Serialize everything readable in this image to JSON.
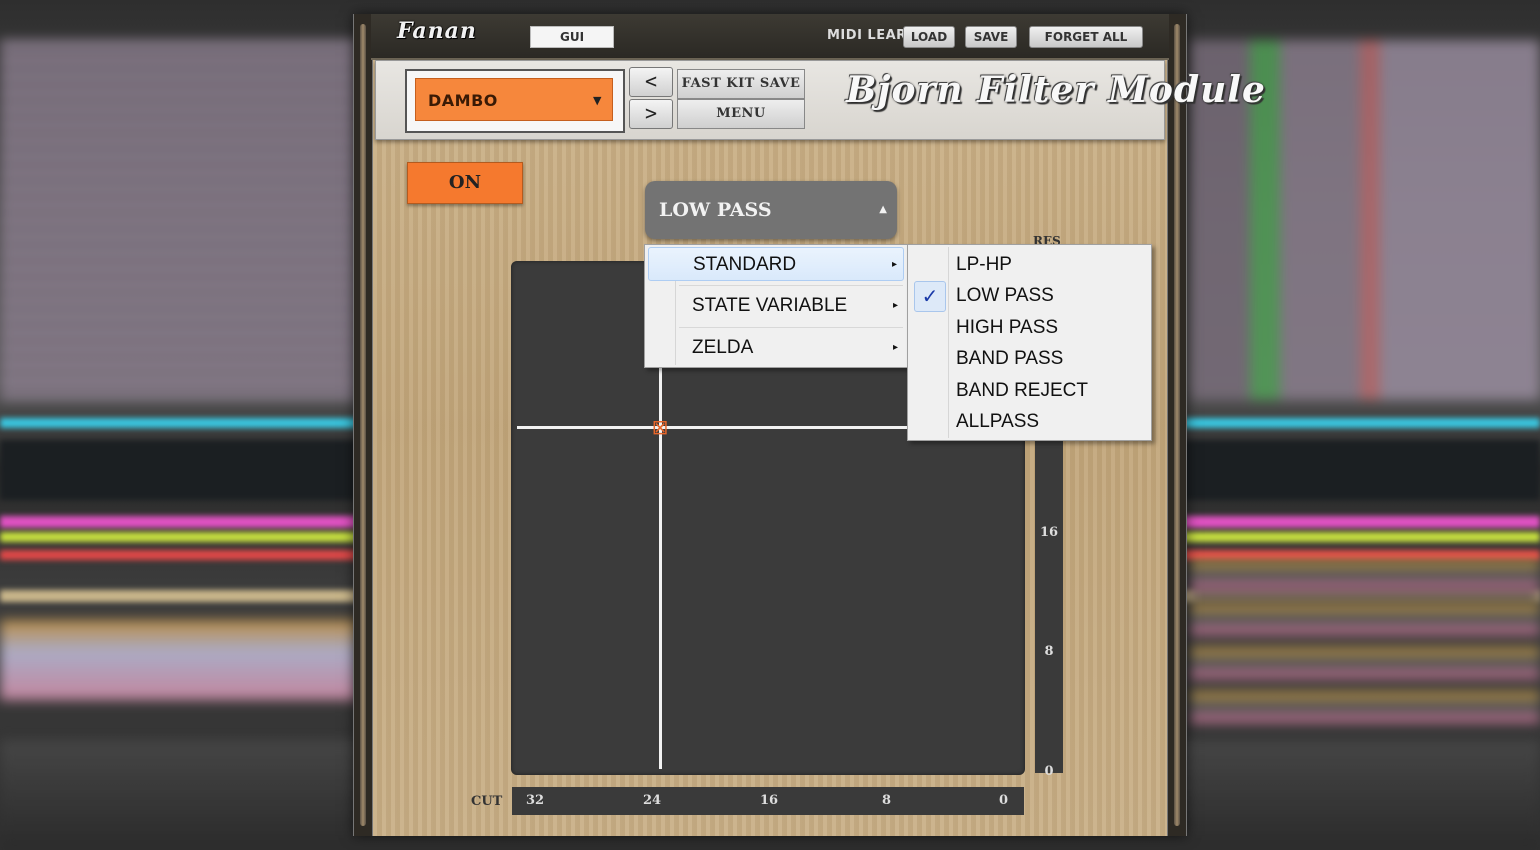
{
  "topbar": {
    "logo_text": "Fanan",
    "gui_label": "GUI",
    "midi_learn_label": "MIDI LEARN",
    "load_label": "LOAD",
    "save_label": "SAVE",
    "forget_all_label": "FORGET ALL"
  },
  "header": {
    "kit_name": "DAMBO",
    "prev_label": "<",
    "next_label": ">",
    "fast_kit_save_label": "FAST KIT SAVE",
    "menu_label": "MENU",
    "title_logo": "Bjorn Filter Module"
  },
  "controls": {
    "on_label": "ON",
    "filter_type": "LOW PASS",
    "res_label": "RES",
    "res_ticks": [
      "16",
      "8",
      "0"
    ],
    "cut_label": "CUT",
    "cut_ticks": [
      "32",
      "24",
      "16",
      "8",
      "0"
    ]
  },
  "menu": {
    "categories": [
      {
        "label": "STANDARD",
        "highlighted": true
      },
      {
        "label": "STATE VARIABLE",
        "highlighted": false
      },
      {
        "label": "ZELDA",
        "highlighted": false
      }
    ],
    "standard_items": [
      {
        "label": "LP-HP",
        "checked": false
      },
      {
        "label": "LOW PASS",
        "checked": true
      },
      {
        "label": "HIGH PASS",
        "checked": false
      },
      {
        "label": "BAND PASS",
        "checked": false
      },
      {
        "label": "BAND REJECT",
        "checked": false
      },
      {
        "label": "ALLPASS",
        "checked": false
      }
    ],
    "check_glyph": "✓",
    "submenu_arrow": "▸"
  },
  "colors": {
    "accent_orange": "#f5792e",
    "pad_background": "#3b3b3b",
    "menu_highlight": "#d9e9fb"
  }
}
